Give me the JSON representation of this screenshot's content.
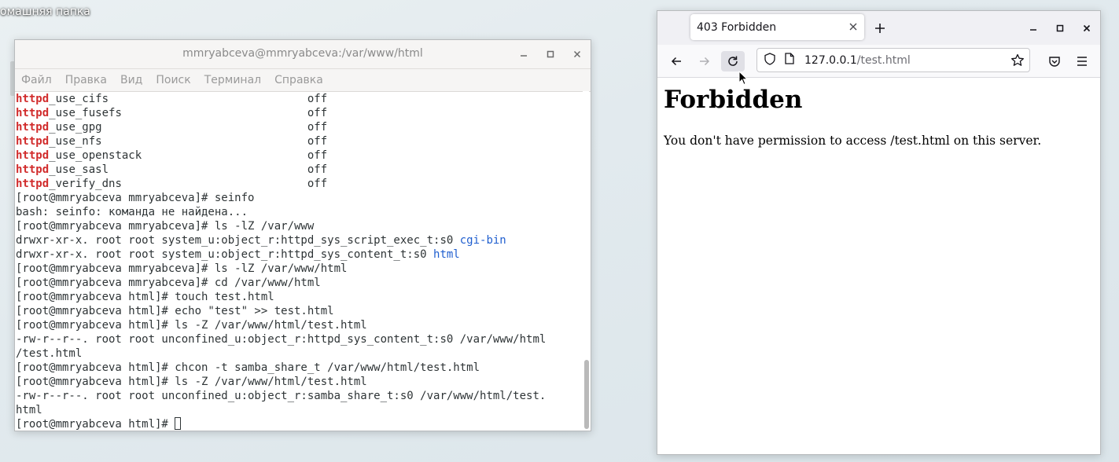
{
  "desktop": {
    "folder_label": "омашняя папка"
  },
  "terminal": {
    "title": "mmryabceva@mmryabceva:/var/www/html",
    "menu": [
      "Файл",
      "Правка",
      "Вид",
      "Поиск",
      "Терминал",
      "Справка"
    ],
    "lines": [
      {
        "parts": [
          {
            "t": "httpd",
            "c": "red"
          },
          {
            "t": "_use_cifs                              off"
          }
        ]
      },
      {
        "parts": [
          {
            "t": "httpd",
            "c": "red"
          },
          {
            "t": "_use_fusefs                            off"
          }
        ]
      },
      {
        "parts": [
          {
            "t": "httpd",
            "c": "red"
          },
          {
            "t": "_use_gpg                               off"
          }
        ]
      },
      {
        "parts": [
          {
            "t": "httpd",
            "c": "red"
          },
          {
            "t": "_use_nfs                               off"
          }
        ]
      },
      {
        "parts": [
          {
            "t": "httpd",
            "c": "red"
          },
          {
            "t": "_use_openstack                         off"
          }
        ]
      },
      {
        "parts": [
          {
            "t": "httpd",
            "c": "red"
          },
          {
            "t": "_use_sasl                              off"
          }
        ]
      },
      {
        "parts": [
          {
            "t": "httpd",
            "c": "red"
          },
          {
            "t": "_verify_dns                            off"
          }
        ]
      },
      {
        "parts": [
          {
            "t": "[root@mmryabceva mmryabceva]# seinfo"
          }
        ]
      },
      {
        "parts": [
          {
            "t": "bash: seinfo: команда не найдена..."
          }
        ]
      },
      {
        "parts": [
          {
            "t": "[root@mmryabceva mmryabceva]# ls -lZ /var/www"
          }
        ]
      },
      {
        "parts": [
          {
            "t": "drwxr-xr-x. root root system_u:object_r:httpd_sys_script_exec_t:s0 "
          },
          {
            "t": "cgi-bin",
            "c": "blue"
          }
        ]
      },
      {
        "parts": [
          {
            "t": "drwxr-xr-x. root root system_u:object_r:httpd_sys_content_t:s0 "
          },
          {
            "t": "html",
            "c": "blue"
          }
        ]
      },
      {
        "parts": [
          {
            "t": "[root@mmryabceva mmryabceva]# ls -lZ /var/www/html"
          }
        ]
      },
      {
        "parts": [
          {
            "t": "[root@mmryabceva mmryabceva]# cd /var/www/html"
          }
        ]
      },
      {
        "parts": [
          {
            "t": "[root@mmryabceva html]# touch test.html"
          }
        ]
      },
      {
        "parts": [
          {
            "t": "[root@mmryabceva html]# echo \"test\" >> test.html"
          }
        ]
      },
      {
        "parts": [
          {
            "t": "[root@mmryabceva html]# ls -Z /var/www/html/test.html"
          }
        ]
      },
      {
        "parts": [
          {
            "t": "-rw-r--r--. root root unconfined_u:object_r:httpd_sys_content_t:s0 /var/www/html"
          }
        ]
      },
      {
        "parts": [
          {
            "t": "/test.html"
          }
        ]
      },
      {
        "parts": [
          {
            "t": "[root@mmryabceva html]# chcon -t samba_share_t /var/www/html/test.html"
          }
        ]
      },
      {
        "parts": [
          {
            "t": "[root@mmryabceva html]# ls -Z /var/www/html/test.html"
          }
        ]
      },
      {
        "parts": [
          {
            "t": "-rw-r--r--. root root unconfined_u:object_r:samba_share_t:s0 /var/www/html/test."
          }
        ]
      },
      {
        "parts": [
          {
            "t": "html"
          }
        ]
      }
    ],
    "prompt": "[root@mmryabceva html]# "
  },
  "browser": {
    "tab_title": "403 Forbidden",
    "url_host": "127.0.0.1",
    "url_path": "/test.html",
    "page_heading": "Forbidden",
    "page_text": "You don't have permission to access /test.html on this server."
  },
  "colors": {
    "terminal_red": "#d12b2b",
    "terminal_blue": "#1f5ecf"
  }
}
